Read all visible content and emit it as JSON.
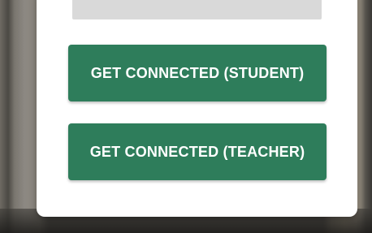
{
  "modal": {
    "input_value": "",
    "buttons": {
      "student_label": "GET CONNECTED (STUDENT)",
      "teacher_label": "GET CONNECTED (TEACHER)"
    }
  },
  "colors": {
    "button_bg": "#2e7d5b",
    "button_text": "#ffffff",
    "input_bg": "#d9d9d9",
    "modal_bg": "#ffffff"
  }
}
